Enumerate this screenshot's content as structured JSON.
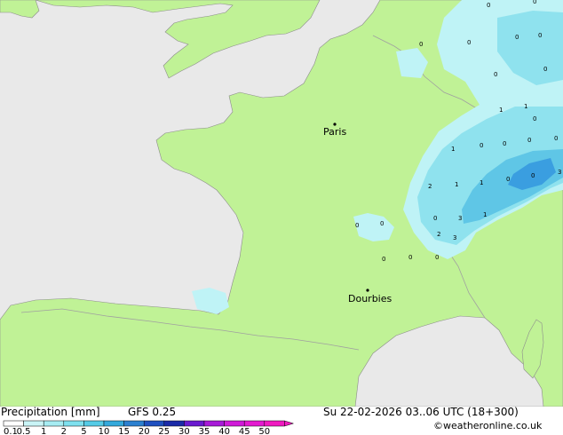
{
  "title": "Precipitation [mm]",
  "model": "GFS 0.25",
  "datetime": "Su 22-02-2026 03..06 UTC (18+300)",
  "copyright": "©weatheronline.co.uk",
  "colors": {
    "sea": "#e9e9e9",
    "land": "#c0f296",
    "border": "#a0a0a0",
    "coast": "#8c8c8c",
    "precip_light": "#bff3f6",
    "precip_mid": "#8fe2ee",
    "precip_high": "#5fc6e6",
    "precip_heavy": "#3a9ee0"
  },
  "legend": {
    "labels": [
      "0.1",
      "0.5",
      "1",
      "2",
      "5",
      "10",
      "15",
      "20",
      "25",
      "30",
      "35",
      "40",
      "45",
      "50"
    ],
    "colors": [
      "#ffffff",
      "#c9f4f6",
      "#a6ecf2",
      "#7ee0ee",
      "#55cbe6",
      "#33a9dc",
      "#2b80d0",
      "#1f50c0",
      "#1a2aa8",
      "#6a1ad0",
      "#a81ad8",
      "#d01ad8",
      "#e41ad0",
      "#f01ac0"
    ]
  },
  "cities": [
    {
      "name": "Paris"
    },
    {
      "name": "Dourbies"
    }
  ],
  "precip_values": [
    "0",
    "0",
    "0",
    "0",
    "0",
    "0",
    "0",
    "1",
    "1",
    "0",
    "0",
    "1",
    "0",
    "0",
    "0",
    "2",
    "1",
    "1",
    "0",
    "0",
    "3",
    "0",
    "3",
    "1",
    "2",
    "3",
    "0",
    "0",
    "0",
    "0",
    "0",
    "0"
  ]
}
